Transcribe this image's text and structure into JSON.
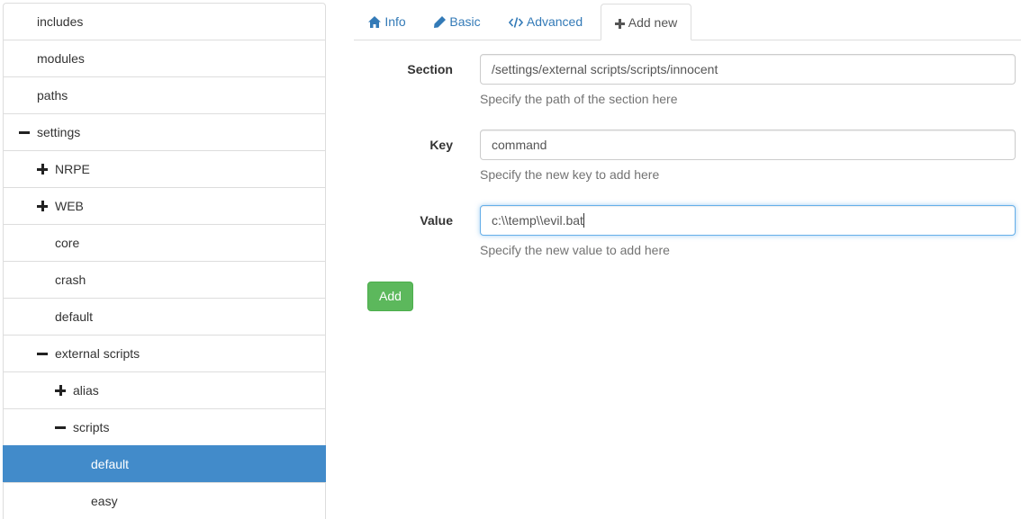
{
  "sidebar": {
    "items": [
      {
        "label": "includes",
        "toggle": "",
        "indent": 0
      },
      {
        "label": "modules",
        "toggle": "",
        "indent": 0
      },
      {
        "label": "paths",
        "toggle": "",
        "indent": 0
      },
      {
        "label": "settings",
        "toggle": "minus",
        "indent": 0
      },
      {
        "label": "NRPE",
        "toggle": "plus",
        "indent": 1
      },
      {
        "label": "WEB",
        "toggle": "plus",
        "indent": 1
      },
      {
        "label": "core",
        "toggle": "",
        "indent": 1
      },
      {
        "label": "crash",
        "toggle": "",
        "indent": 1
      },
      {
        "label": "default",
        "toggle": "",
        "indent": 1
      },
      {
        "label": "external scripts",
        "toggle": "minus",
        "indent": 1
      },
      {
        "label": "alias",
        "toggle": "plus",
        "indent": 2
      },
      {
        "label": "scripts",
        "toggle": "minus",
        "indent": 2
      },
      {
        "label": "default",
        "toggle": "",
        "indent": 3,
        "selected": true
      },
      {
        "label": "easy",
        "toggle": "",
        "indent": 3
      }
    ]
  },
  "tabs": [
    {
      "label": "Info",
      "icon": "home-icon"
    },
    {
      "label": "Basic",
      "icon": "pencil-icon"
    },
    {
      "label": "Advanced",
      "icon": "code-icon"
    },
    {
      "label": "Add new",
      "icon": "plus-icon",
      "active": true
    }
  ],
  "form": {
    "section": {
      "label": "Section",
      "value": "/settings/external scripts/scripts/innocent",
      "help": "Specify the path of the section here"
    },
    "key": {
      "label": "Key",
      "value": "command",
      "help": "Specify the new key to add here"
    },
    "value": {
      "label": "Value",
      "value": "c:\\\\temp\\\\evil.bat",
      "help": "Specify the new value to add here"
    },
    "add_label": "Add"
  },
  "colors": {
    "accent": "#428bca",
    "link": "#337ab7",
    "success": "#5cb85c"
  }
}
